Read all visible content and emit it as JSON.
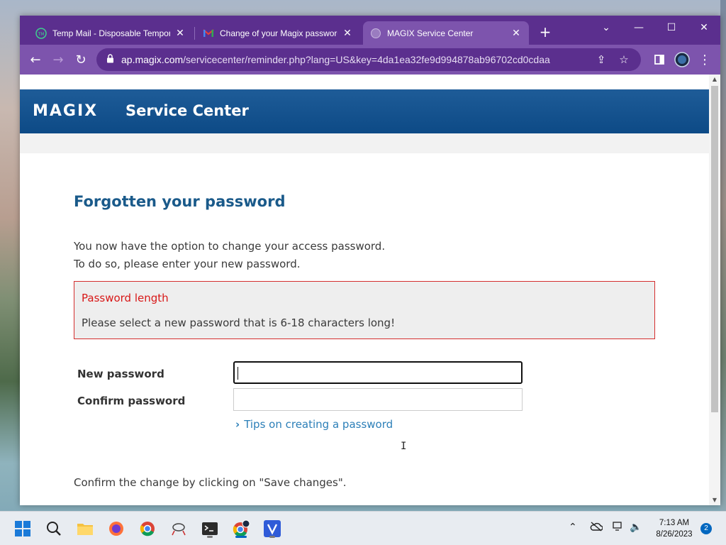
{
  "browser": {
    "tabs": [
      {
        "title": "Temp Mail - Disposable Tempora",
        "favicon": "tempmail-icon",
        "active": false
      },
      {
        "title": "Change of your Magix password",
        "favicon": "gmail-icon",
        "active": false
      },
      {
        "title": "MAGIX Service Center",
        "favicon": "magix-icon",
        "active": true
      }
    ],
    "url_host": "ap.magix.com",
    "url_path": "/servicecenter/reminder.php?lang=US&key=4da1ea32fe9d994878ab96702cd0cdaa",
    "accent_color": "#7d54ad",
    "tabstrip_color": "#5b2f8e"
  },
  "page": {
    "logo": "MAGIX",
    "header_title": "Service Center",
    "heading": "Forgotten your password",
    "intro_line1": "You now have the option to change your access password.",
    "intro_line2": "To do so, please enter your new password.",
    "error": {
      "title": "Password length",
      "message": "Please select a new password that is 6-18 characters long!"
    },
    "form": {
      "new_password_label": "New password",
      "new_password_value": "",
      "confirm_password_label": "Confirm password",
      "confirm_password_value": ""
    },
    "tips_link": "Tips on creating a password",
    "confirm_text": "Confirm the change by clicking on \"Save changes\".",
    "header_color": "#0d4a86",
    "heading_color": "#1a5a8a",
    "error_color": "#d81818",
    "link_color": "#2c7fb8"
  },
  "taskbar": {
    "time": "7:13 AM",
    "date": "8/26/2023",
    "notification_count": "2",
    "apps": [
      "start-icon",
      "search-icon",
      "file-explorer-icon",
      "firefox-icon",
      "chrome-icon",
      "network-tool-icon",
      "terminal-icon",
      "chrome-profile-icon",
      "vpn-icon"
    ]
  }
}
